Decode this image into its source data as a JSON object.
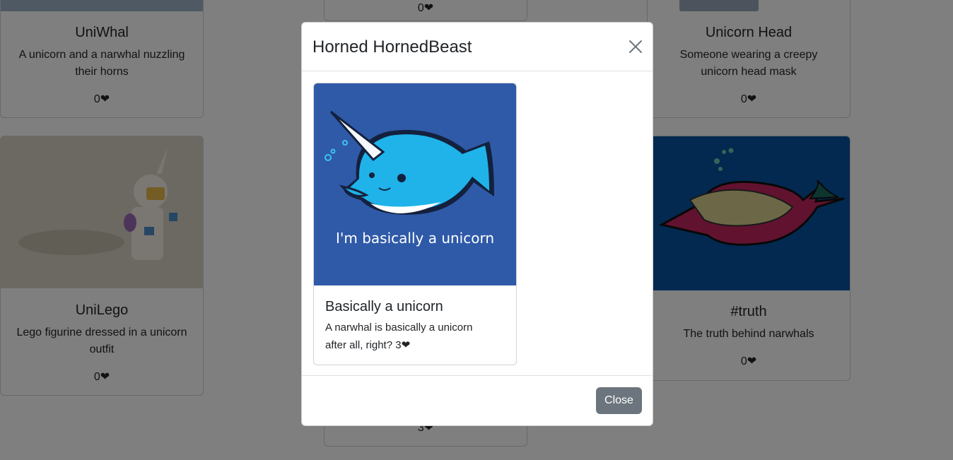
{
  "background_cards": [
    {
      "title": "UniWhal",
      "description": "A unicorn and a narwhal nuzzling their horns",
      "likes": "0"
    },
    {
      "title": "",
      "description": "",
      "likes": "0"
    },
    {
      "title": "Unicorn Head",
      "description": "Someone wearing a creepy unicorn head mask",
      "likes": "0"
    },
    {
      "title": "UniLego",
      "description": "Lego figurine dressed in a unicorn outfit",
      "likes": "0"
    },
    {
      "title": "#truth",
      "description": "The truth behind narwhals",
      "likes": "0"
    },
    {
      "title": "",
      "description": "",
      "likes": "3"
    }
  ],
  "heart_symbol": "❤",
  "modal": {
    "title": "Horned HornedBeast",
    "close_icon": "close-icon",
    "card": {
      "title": "Basically a unicorn",
      "description": "A narwhal is basically a unicorn after all, right? 3",
      "image_caption": "I'm basically a unicorn"
    },
    "close_button": "Close"
  },
  "colors": {
    "backdrop": "rgba(0,0,0,0.5)",
    "narwhal_bg": "#2f5aa8",
    "truth_bg": "#0652a1",
    "secondary_button": "#6c757d"
  }
}
